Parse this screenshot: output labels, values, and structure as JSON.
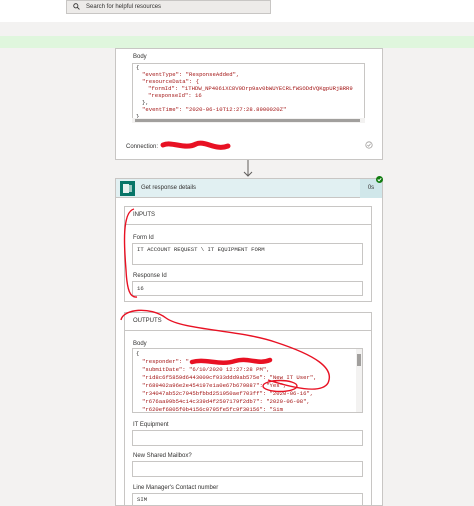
{
  "search": {
    "placeholder": "Search for helpful resources"
  },
  "top_card": {
    "body_label": "Body",
    "lines": [
      "{",
      "\"eventType\": \"ResponseAdded\",",
      "\"resourceData\": {",
      "\"formId\": \"1THDW_NP4061XC8V9Drp9av0bWUYECRLfWSODdVQKgpURjBRR9",
      "\"responseId\": 16",
      "},",
      "\"eventTime\": \"2020-06-10T12:27:28.8900020Z\"",
      "}"
    ],
    "connection_label": "Connection:"
  },
  "action": {
    "title": "Get response details",
    "badge": "0s"
  },
  "inputs": {
    "section_label": "INPUTS",
    "form_id_label": "Form Id",
    "form_id_value": "IT ACCOUNT REQUEST \\ IT EQUIPMENT FORM",
    "response_id_label": "Response Id",
    "response_id_value": "16"
  },
  "outputs": {
    "section_label": "OUTPUTS",
    "body_label": "Body",
    "lines": [
      "{",
      "\"responder\": \"",
      "\"submitDate\": \"6/10/2020 12:27:28 PM\",",
      "\"r1d8c6f5859d6443009cf933ddd9ab575e\": \"New IT User\",",
      "\"r689402a96e2e454197e1a0e67b679887\": \"Yes\",",
      "\"r34047ab52c7945bfbbd251950aef703ff\": \"2020-06-16\",",
      "\"r676aa99b54c14c339d4f2507179f2db7\": \"2020-06-08\",",
      "\"r620ef6805f0b4156c0795fe5fc9f30156\": \"Sim"
    ],
    "it_equipment_label": "IT Equipment",
    "shared_mailbox_label": "New Shared Mailbox?",
    "line_manager_label": "Line Manager's Contact number",
    "line_manager_value": "SIM"
  }
}
